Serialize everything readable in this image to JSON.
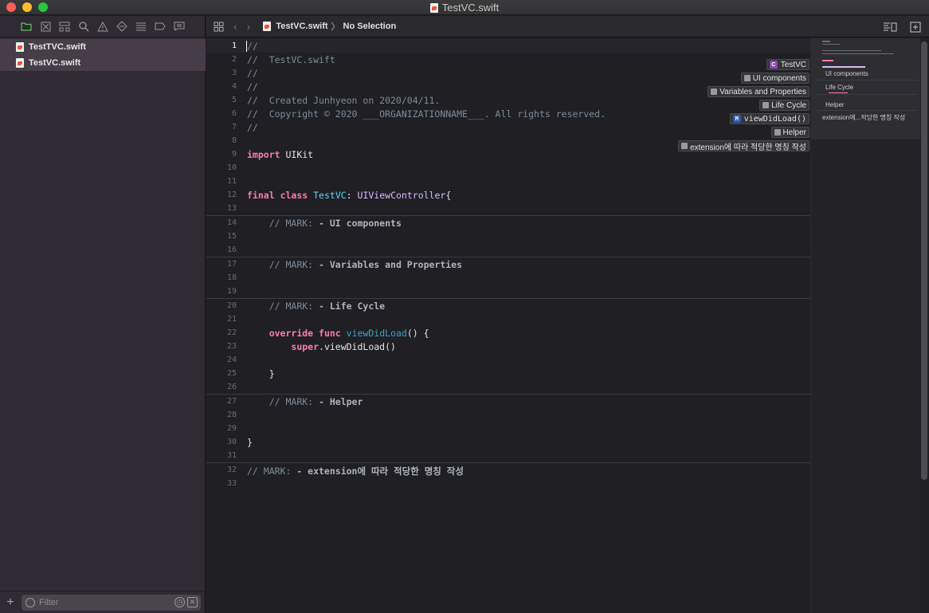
{
  "window": {
    "title": "TestVC.swift"
  },
  "navigator": {
    "toolbar_icons": [
      "folder-icon",
      "source-control-icon",
      "hierarchy-icon",
      "search-icon",
      "warning-icon",
      "test-icon",
      "debug-icon",
      "breakpoint-icon",
      "report-icon"
    ],
    "files": [
      {
        "name": "TestTVC.swift"
      },
      {
        "name": "TestVC.swift"
      }
    ],
    "filter": {
      "placeholder": "Filter"
    }
  },
  "jumpbar": {
    "file": "TestVC.swift",
    "selection": "No Selection"
  },
  "editor": {
    "line_numbers": [
      "1",
      "2",
      "3",
      "4",
      "5",
      "6",
      "7",
      "8",
      "9",
      "10",
      "11",
      "12",
      "13",
      "14",
      "15",
      "16",
      "17",
      "18",
      "19",
      "20",
      "21",
      "22",
      "23",
      "24",
      "25",
      "26",
      "27",
      "28",
      "29",
      "30",
      "31",
      "32",
      "33"
    ],
    "code": {
      "l1": "//",
      "l2": "//  TestVC.swift",
      "l3": "//",
      "l4": "//",
      "l5": "//  Created Junhyeon on 2020/04/11.",
      "l6": "//  Copyright © 2020 ___ORGANIZATIONNAME___. All rights reserved.",
      "l7": "//",
      "l9_kw": "import",
      "l9_rest": " UIKit",
      "l12_kw1": "final",
      "l12_kw2": "class",
      "l12_type": "TestVC",
      "l12_colon": ": ",
      "l12_super": "UIViewController",
      "l12_brace": "{",
      "l14_mark": "// MARK: ",
      "l14_title": "- UI components",
      "l17_mark": "// MARK: ",
      "l17_title": "- Variables and Properties",
      "l20_mark": "// MARK: ",
      "l20_title": "- Life Cycle",
      "l22_kw1": "override",
      "l22_kw2": "func",
      "l22_fn": "viewDidLoad",
      "l22_rest": "() {",
      "l23_kw": "super",
      "l23_rest": ".viewDidLoad()",
      "l25": "}",
      "l27_mark": "// MARK: ",
      "l27_title": "- Helper",
      "l30": "}",
      "l32_mark": "// MARK: ",
      "l32_title": "- extension에 따라 적당한 명칭 작성"
    }
  },
  "minimap": {
    "labels": [
      "UI components",
      "Life Cycle",
      "Helper",
      "extension에...적당한 명칭 작성"
    ]
  },
  "outline_tags": [
    {
      "badge": "C",
      "label": "TestVC"
    },
    {
      "label": "UI components"
    },
    {
      "label": "Variables and Properties"
    },
    {
      "label": "Life Cycle"
    },
    {
      "badge": "M",
      "label": "viewDidLoad()"
    },
    {
      "label": "Helper"
    },
    {
      "label": "extension에 따라 적당한 명칭 작성"
    }
  ]
}
